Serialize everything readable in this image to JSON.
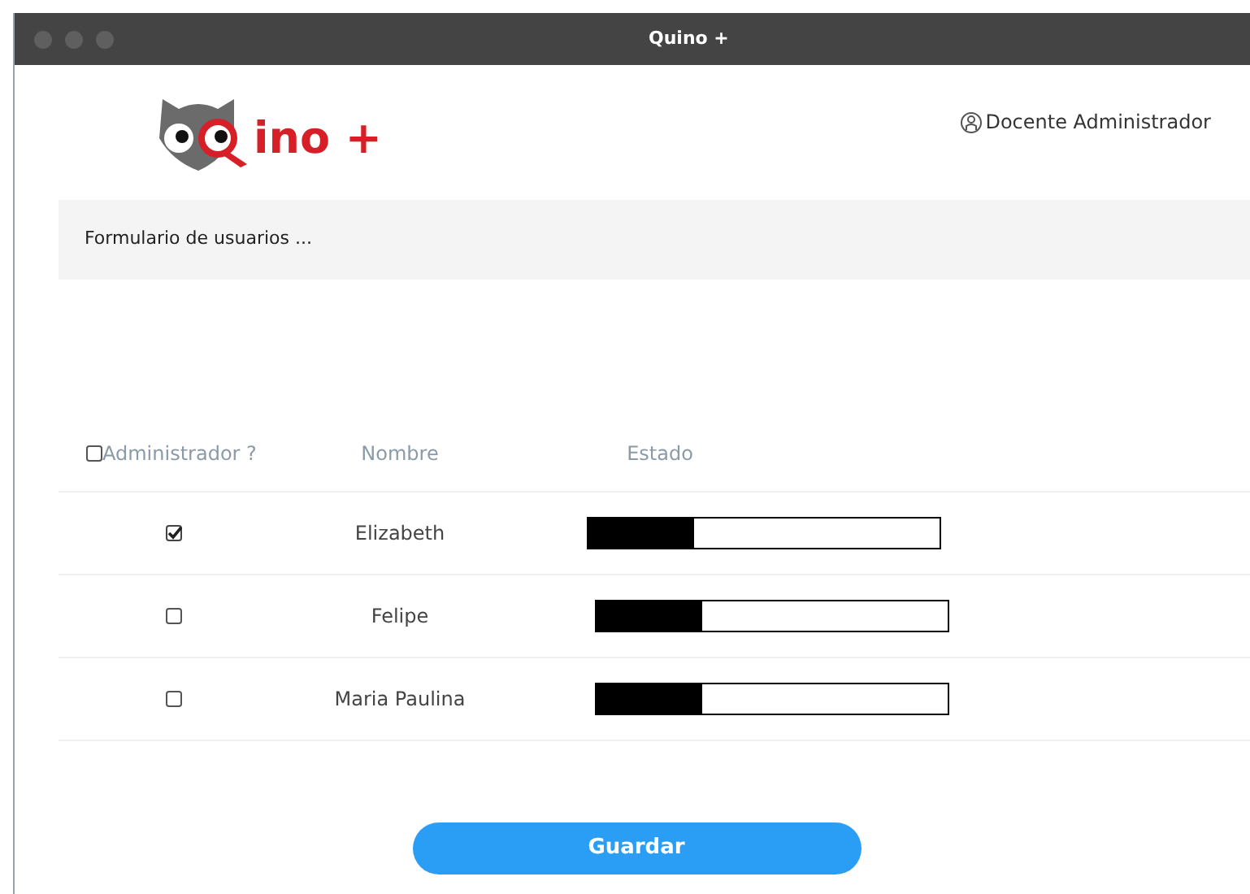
{
  "window": {
    "title": "Quino +"
  },
  "logo": {
    "text": "ino +"
  },
  "user": {
    "label": "Docente Administrador"
  },
  "form_banner": {
    "text": "Formulario de usuarios ..."
  },
  "table": {
    "columns": [
      {
        "label": "Administrador ?",
        "checked": false
      },
      {
        "label": "Nombre"
      },
      {
        "label": "Estado"
      }
    ],
    "rows": [
      {
        "checked": true,
        "name": "Elizabeth",
        "level": 0.3
      },
      {
        "checked": false,
        "name": "Felipe",
        "level": 0.3
      },
      {
        "checked": false,
        "name": "Maria Paulina",
        "level": 0.3
      }
    ]
  },
  "buttons": [
    {
      "label": "Guardar"
    }
  ]
}
